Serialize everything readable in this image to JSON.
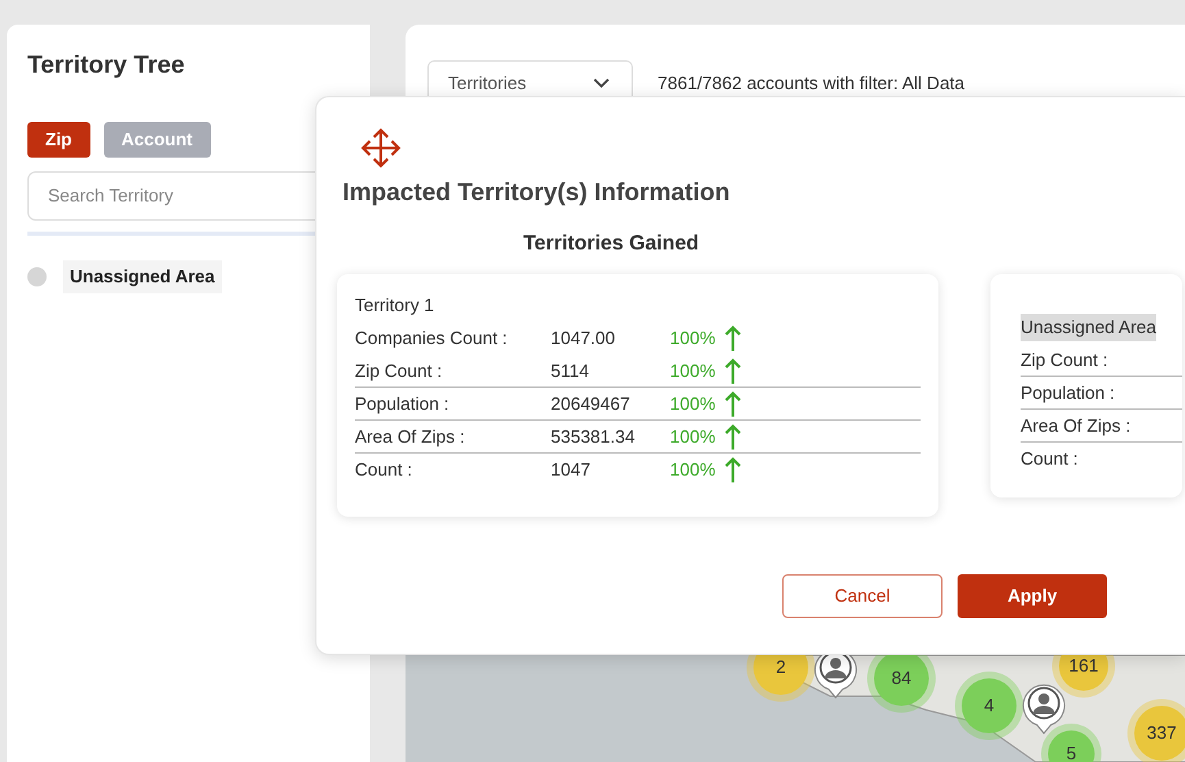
{
  "left_panel": {
    "title": "Territory Tree",
    "toggle": [
      {
        "label": "Zip",
        "selected": true
      },
      {
        "label": "Account",
        "selected": false
      }
    ],
    "search": {
      "placeholder": "Search Territory"
    },
    "tree": [
      {
        "label": "Unassigned Area"
      }
    ]
  },
  "main": {
    "dropdown": {
      "value": "Territories"
    },
    "filter_text": "7861/7862 accounts with filter: All Data",
    "map": {
      "clusters": [
        {
          "label": "2",
          "color": "#e9c63c"
        },
        {
          "label": "84",
          "color": "#7ccf5a"
        },
        {
          "label": "4",
          "color": "#7ccf5a"
        },
        {
          "label": "161",
          "color": "#e9c63c"
        },
        {
          "label": "337",
          "color": "#e9c63c"
        },
        {
          "label": "5",
          "color": "#7ccf5a"
        }
      ]
    }
  },
  "dialog": {
    "title": "Impacted Territory(s) Information",
    "section_title": "Territories Gained",
    "cards": [
      {
        "header": "Territory 1",
        "rows": [
          {
            "label": "Companies Count :",
            "value": "1047.00",
            "change": "100%"
          },
          {
            "label": "Zip Count :",
            "value": "5114",
            "change": "100%"
          },
          {
            "label": "Population :",
            "value": "20649467",
            "change": "100%"
          },
          {
            "label": "Area Of Zips :",
            "value": "535381.34",
            "change": "100%"
          },
          {
            "label": "Count :",
            "value": "1047",
            "change": "100%"
          }
        ]
      },
      {
        "header": "Unassigned Area",
        "rows": [
          {
            "label": "Zip Count :"
          },
          {
            "label": "Population :"
          },
          {
            "label": "Area Of Zips :"
          },
          {
            "label": "Count :"
          }
        ]
      }
    ],
    "buttons": [
      {
        "label": "Cancel",
        "kind": "secondary"
      },
      {
        "label": "Apply",
        "kind": "primary"
      }
    ]
  }
}
